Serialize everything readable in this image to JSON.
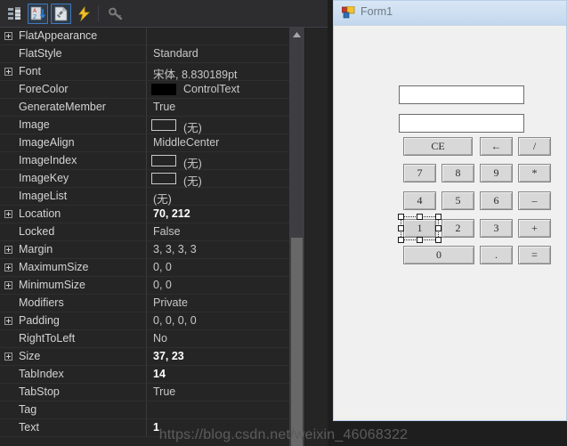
{
  "app": {
    "theme_bg": "#252526",
    "toolbar_bg": "#2d2d30",
    "accent": "#3e7bbf"
  },
  "properties_pane": {
    "toolbar": {
      "buttons": [
        {
          "name": "categorized-view-icon",
          "label": "Categorized",
          "selected": false
        },
        {
          "name": "alphabetical-sort-icon",
          "label": "Alphabetical",
          "selected": true
        },
        {
          "name": "properties-icon",
          "label": "Properties",
          "selected": true
        },
        {
          "name": "events-icon",
          "label": "Events",
          "selected": false
        },
        {
          "name": "property-pages-icon",
          "label": "Property Pages",
          "selected": false
        }
      ]
    },
    "rows": [
      {
        "name": "FlatAppearance",
        "value": "",
        "expandable": true,
        "bold": false,
        "swatch": "none"
      },
      {
        "name": "FlatStyle",
        "value": "Standard",
        "expandable": false,
        "bold": false,
        "swatch": "none"
      },
      {
        "name": "Font",
        "value": "宋体, 8.830189pt",
        "expandable": true,
        "bold": false,
        "swatch": "none"
      },
      {
        "name": "ForeColor",
        "value": "ControlText",
        "expandable": false,
        "bold": false,
        "swatch": "filled"
      },
      {
        "name": "GenerateMember",
        "value": "True",
        "expandable": false,
        "bold": false,
        "swatch": "none"
      },
      {
        "name": "Image",
        "value": "(无)",
        "expandable": false,
        "bold": false,
        "swatch": "empty"
      },
      {
        "name": "ImageAlign",
        "value": "MiddleCenter",
        "expandable": false,
        "bold": false,
        "swatch": "none"
      },
      {
        "name": "ImageIndex",
        "value": "(无)",
        "expandable": false,
        "bold": false,
        "swatch": "empty"
      },
      {
        "name": "ImageKey",
        "value": "(无)",
        "expandable": false,
        "bold": false,
        "swatch": "empty"
      },
      {
        "name": "ImageList",
        "value": "(无)",
        "expandable": false,
        "bold": false,
        "swatch": "none"
      },
      {
        "name": "Location",
        "value": "70, 212",
        "expandable": true,
        "bold": true,
        "swatch": "none"
      },
      {
        "name": "Locked",
        "value": "False",
        "expandable": false,
        "bold": false,
        "swatch": "none"
      },
      {
        "name": "Margin",
        "value": "3, 3, 3, 3",
        "expandable": true,
        "bold": false,
        "swatch": "none"
      },
      {
        "name": "MaximumSize",
        "value": "0, 0",
        "expandable": true,
        "bold": false,
        "swatch": "none"
      },
      {
        "name": "MinimumSize",
        "value": "0, 0",
        "expandable": true,
        "bold": false,
        "swatch": "none"
      },
      {
        "name": "Modifiers",
        "value": "Private",
        "expandable": false,
        "bold": false,
        "swatch": "none"
      },
      {
        "name": "Padding",
        "value": "0, 0, 0, 0",
        "expandable": true,
        "bold": false,
        "swatch": "none"
      },
      {
        "name": "RightToLeft",
        "value": "No",
        "expandable": false,
        "bold": false,
        "swatch": "none"
      },
      {
        "name": "Size",
        "value": "37, 23",
        "expandable": true,
        "bold": true,
        "swatch": "none"
      },
      {
        "name": "TabIndex",
        "value": "14",
        "expandable": false,
        "bold": true,
        "swatch": "none"
      },
      {
        "name": "TabStop",
        "value": "True",
        "expandable": false,
        "bold": false,
        "swatch": "none"
      },
      {
        "name": "Tag",
        "value": "",
        "expandable": false,
        "bold": false,
        "swatch": "none"
      },
      {
        "name": "Text",
        "value": "1",
        "expandable": false,
        "bold": true,
        "swatch": "none"
      }
    ],
    "scrollbar": {
      "up_arrow": "▲"
    }
  },
  "designer": {
    "form": {
      "title": "Form1",
      "textboxes": [
        {
          "name": "display-textbox-1",
          "value": ""
        },
        {
          "name": "display-textbox-2",
          "value": ""
        }
      ],
      "buttons": [
        {
          "label": "CE",
          "name": "button-ce",
          "selected": false
        },
        {
          "label": "←",
          "name": "button-backspace",
          "selected": false
        },
        {
          "label": "/",
          "name": "button-divide",
          "selected": false
        },
        {
          "label": "7",
          "name": "button-7",
          "selected": false
        },
        {
          "label": "8",
          "name": "button-8",
          "selected": false
        },
        {
          "label": "9",
          "name": "button-9",
          "selected": false
        },
        {
          "label": "*",
          "name": "button-multiply",
          "selected": false
        },
        {
          "label": "4",
          "name": "button-4",
          "selected": false
        },
        {
          "label": "5",
          "name": "button-5",
          "selected": false
        },
        {
          "label": "6",
          "name": "button-6",
          "selected": false
        },
        {
          "label": "–",
          "name": "button-minus",
          "selected": false
        },
        {
          "label": "1",
          "name": "button-1",
          "selected": true
        },
        {
          "label": "2",
          "name": "button-2",
          "selected": false
        },
        {
          "label": "3",
          "name": "button-3",
          "selected": false
        },
        {
          "label": "+",
          "name": "button-plus",
          "selected": false
        },
        {
          "label": "0",
          "name": "button-0",
          "selected": false
        },
        {
          "label": ".",
          "name": "button-decimal",
          "selected": false
        },
        {
          "label": "=",
          "name": "button-equals",
          "selected": false
        }
      ]
    }
  },
  "watermark": {
    "text": "https://blog.csdn.net/weixin_46068322"
  }
}
